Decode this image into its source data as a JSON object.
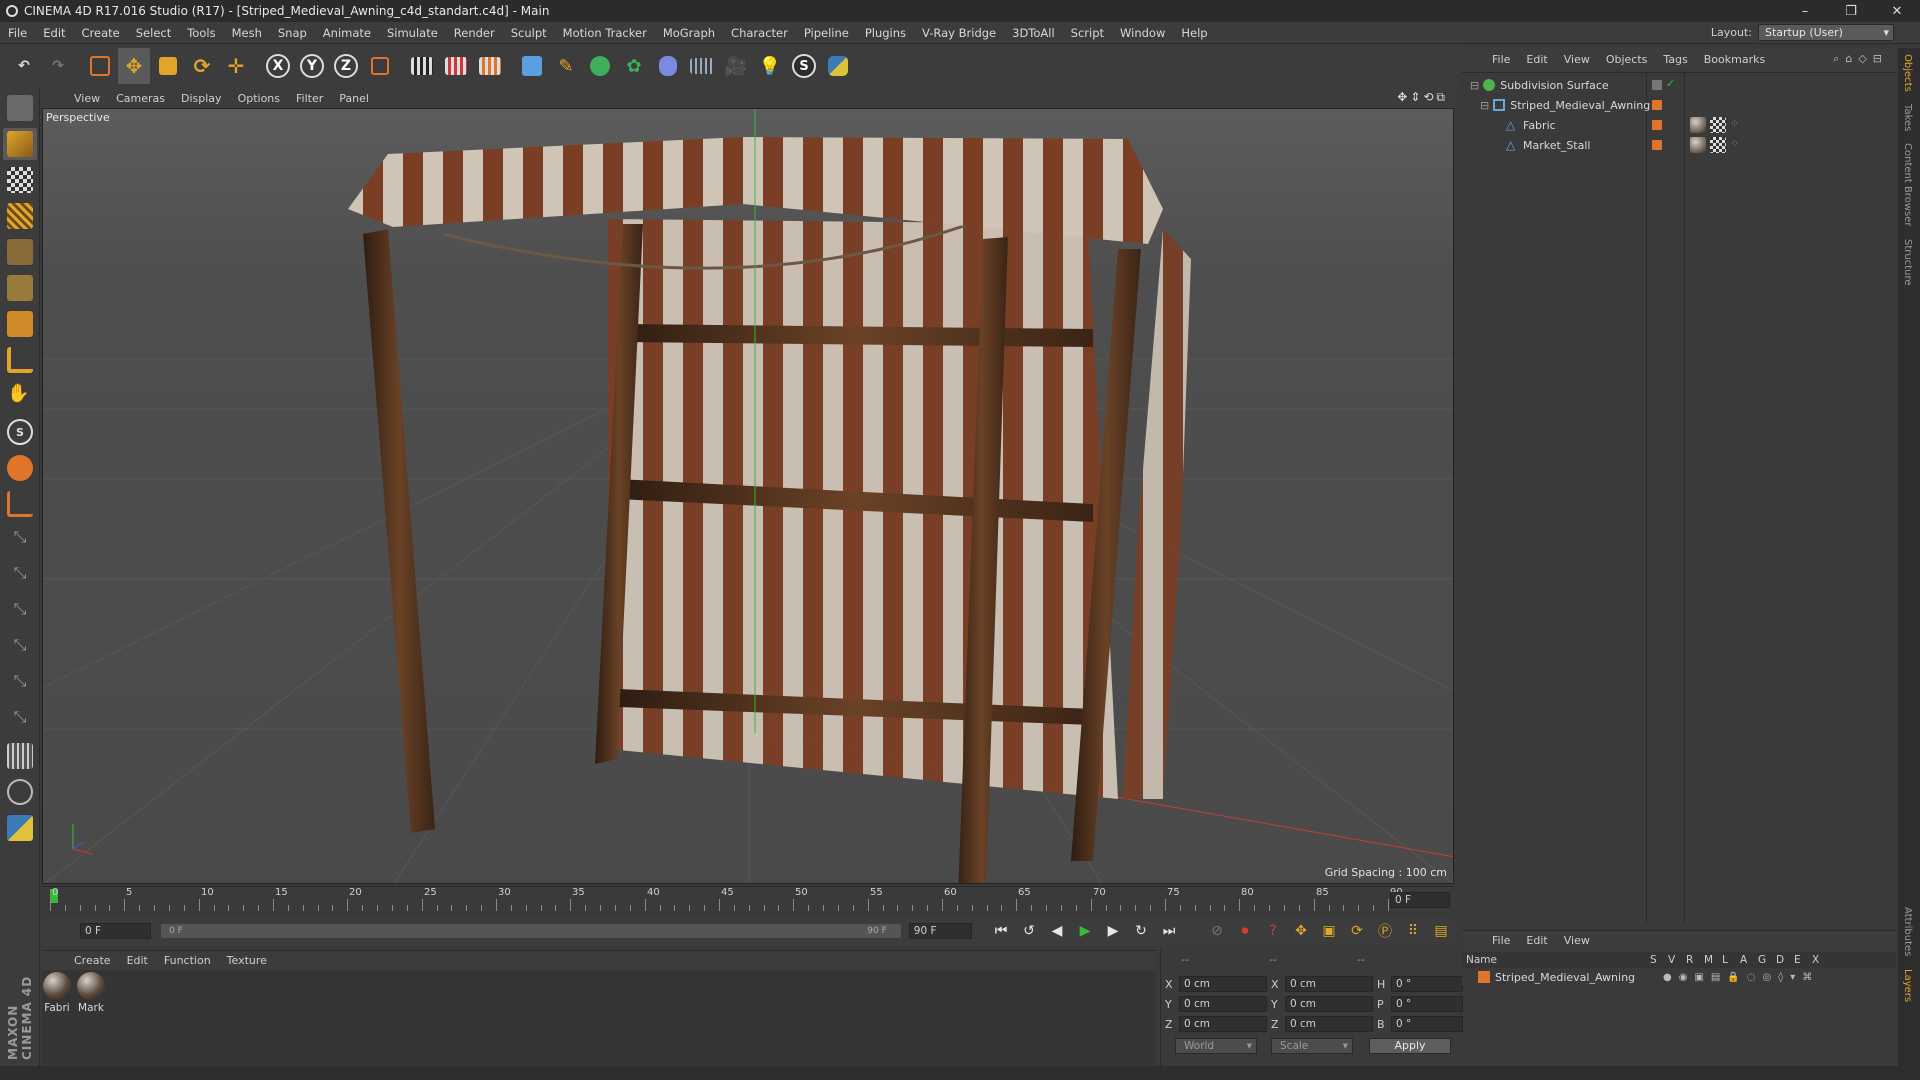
{
  "window": {
    "title": "CINEMA 4D R17.016 Studio (R17) - [Striped_Medieval_Awning_c4d_standart.c4d] - Main",
    "controls": [
      "–",
      "❐",
      "✕"
    ]
  },
  "menubar": {
    "items": [
      "File",
      "Edit",
      "Create",
      "Select",
      "Tools",
      "Mesh",
      "Snap",
      "Animate",
      "Simulate",
      "Render",
      "Sculpt",
      "Motion Tracker",
      "MoGraph",
      "Character",
      "Pipeline",
      "Plugins",
      "V-Ray Bridge",
      "3DToAll",
      "Script",
      "Window",
      "Help"
    ],
    "layout_label": "Layout:",
    "layout_value": "Startup (User)"
  },
  "toolbar": {
    "axis_x": "X",
    "axis_y": "Y",
    "axis_z": "Z"
  },
  "viewport": {
    "menu": [
      "View",
      "Cameras",
      "Display",
      "Options",
      "Filter",
      "Panel"
    ],
    "label": "Perspective",
    "grid_spacing": "Grid Spacing : 100 cm",
    "nav_icons": "✥⇕⟲⧉"
  },
  "timeline": {
    "ticks": [
      "0",
      "5",
      "10",
      "15",
      "20",
      "25",
      "30",
      "35",
      "40",
      "45",
      "50",
      "55",
      "60",
      "65",
      "70",
      "75",
      "80",
      "85",
      "90"
    ],
    "current_frame_right": "0 F"
  },
  "playbar": {
    "start_field": "0 F",
    "range_start": "0 F",
    "range_end": "90 F",
    "end_field": "90 F"
  },
  "material_manager": {
    "menu": [
      "Create",
      "Edit",
      "Function",
      "Texture"
    ],
    "materials": [
      {
        "name": "Fabri"
      },
      {
        "name": "Mark"
      }
    ]
  },
  "coordinates": {
    "head": [
      "--",
      "--",
      "--"
    ],
    "rows": [
      {
        "a": "X",
        "a_val": "0 cm",
        "b": "X",
        "b_val": "0 cm",
        "c": "H",
        "c_val": "0 °"
      },
      {
        "a": "Y",
        "a_val": "0 cm",
        "b": "Y",
        "b_val": "0 cm",
        "c": "P",
        "c_val": "0 °"
      },
      {
        "a": "Z",
        "a_val": "0 cm",
        "b": "Z",
        "b_val": "0 cm",
        "c": "B",
        "c_val": "0 °"
      }
    ],
    "mode": "World",
    "transform": "Scale",
    "apply": "Apply"
  },
  "object_manager": {
    "menu": [
      "File",
      "Edit",
      "View",
      "Objects",
      "Tags",
      "Bookmarks"
    ],
    "objects": [
      {
        "name": "Subdivision Surface",
        "icon_color": "#4fb24f"
      },
      {
        "name": "Striped_Medieval_Awning",
        "icon_color": "#6aa6d8"
      },
      {
        "name": "Fabric",
        "icon_color": "#6aa6d8"
      },
      {
        "name": "Market_Stall",
        "icon_color": "#6aa6d8"
      }
    ]
  },
  "layer_manager": {
    "menu": [
      "File",
      "Edit",
      "View"
    ],
    "columns": [
      "Name",
      "S",
      "V",
      "R",
      "M",
      "L",
      "A",
      "G",
      "D",
      "E",
      "X"
    ],
    "layers": [
      {
        "name": "Striped_Medieval_Awning",
        "color": "#e0742a"
      }
    ]
  },
  "right_tabs": [
    "Objects",
    "Takes",
    "Content Browser",
    "Structure",
    "Attributes",
    "Layers"
  ],
  "brand": "MAXON CINEMA 4D",
  "colors": {
    "accent_orange": "#e0742a",
    "accent_blue": "#3d8ee0",
    "axis_x": "#c83a3a",
    "axis_y": "#3ab83a",
    "axis_z": "#3a5ad8"
  }
}
